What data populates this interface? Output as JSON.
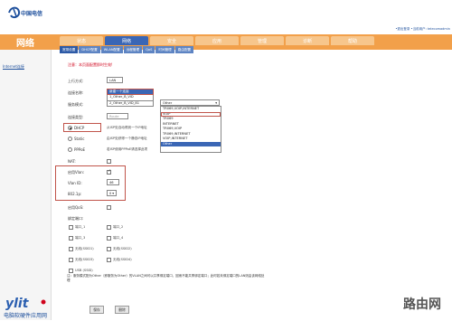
{
  "header": {
    "logo_text": "中国电信",
    "top_links": "•退出登录  •当前用户: telecomadmin"
  },
  "section_title": "网络",
  "tabs": [
    "状态",
    "网络",
    "安全",
    "应用",
    "管理",
    "诊断",
    "帮助"
  ],
  "subnav": [
    "宽带设置",
    "DHCP配置",
    "WLAN配置",
    "远程管理",
    "QoS",
    "时间管理",
    "路由配置"
  ],
  "sidebar": {
    "link": "Internet连接"
  },
  "form": {
    "notice": "注意：本页面配置即时生效!",
    "upstream_label": "上行方式:",
    "upstream_value": "LAN",
    "conn_name_label": "连接名称:",
    "conn_name_value": "新建一个连接",
    "conn_name_options": [
      "1_Other_B_VID",
      "2_Other_B_VID_81"
    ],
    "service_mode_label": "服务模式:",
    "service_mode_value": "Other",
    "service_mode_options": [
      "TR069,VOIP,INTERNET",
      "VOIP",
      "TR069",
      "INTERNET",
      "TR069,VOIP",
      "TR069,INTERNET",
      "VOIP,INTERNET",
      "Other"
    ],
    "conn_type_label": "连接类型:",
    "conn_type_value": "Route",
    "modes": [
      {
        "label": "DHCP",
        "desc": "从ISP处自动得到一个IP地址",
        "selected": true
      },
      {
        "label": "Static",
        "desc": "由ISP处获得一个静态IP地址",
        "selected": false
      },
      {
        "label": "PPPoE",
        "desc": "若ISP使用PPPoE请选择此项",
        "selected": false
      }
    ],
    "nat_label": "NAT:",
    "vlan_enable_label": "启用Vlan:",
    "vlan_id_label": "Vlan ID:",
    "vlan_id_value": "46",
    "p8021_label": "802.1p:",
    "p8021_value": "0",
    "qos_label": "启用QoS:",
    "bind_label": "绑定端口:",
    "ports": [
      "端口_1",
      "端口_2",
      "端口_3",
      "端口_4",
      "无线(SSID1)",
      "无线(SSID2)",
      "无线(SSID3)",
      "无线(SSID4)"
    ],
    "usb_label": "USB (SSID)",
    "note": "注：服务模式配为Other（即服务为Other）的VLAN之间可以共享绑定端口，因而不能共享绑定端口；此时若未绑定端口的LAN则由该网络处理",
    "save_button": "保存",
    "delete_button": "删除"
  },
  "watermarks": {
    "left": "电脑软硬件应用网",
    "right": "路由网"
  },
  "colors": {
    "accent_orange": "#f2a04a",
    "tab_blue": "#3a66b5",
    "highlight_red": "#c0544a",
    "notice_red": "#d0021b"
  }
}
